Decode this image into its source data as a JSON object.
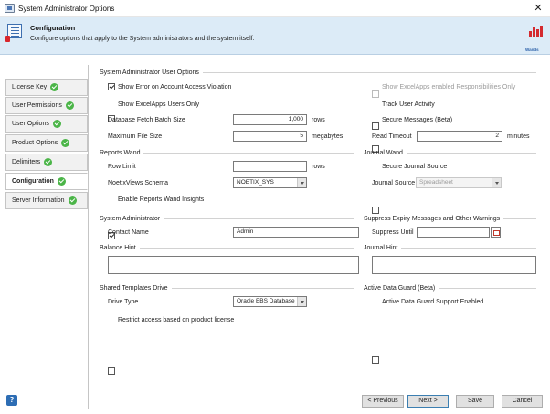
{
  "window": {
    "title": "System Administrator Options",
    "close_glyph": "✕"
  },
  "header": {
    "title": "Configuration",
    "description": "Configure options that apply to the System administrators and the system itself.",
    "logo_text": "Wands"
  },
  "nav": {
    "items": [
      {
        "label": "License Key",
        "done": true
      },
      {
        "label": "User Permissions",
        "done": true
      },
      {
        "label": "User Options",
        "done": true
      },
      {
        "label": "Product Options",
        "done": true
      },
      {
        "label": "Delimiters",
        "done": true
      },
      {
        "label": "Configuration",
        "done": true,
        "active": true
      },
      {
        "label": "Server Information",
        "done": true
      }
    ]
  },
  "sections": {
    "sys_admin_user_options": {
      "title": "System Administrator User Options",
      "show_error_on_violation": {
        "label": "Show Error on Account Access Violation",
        "checked": true
      },
      "show_excelapps_resp_only": {
        "label": "Show ExcelApps enabled Responsibilities Only",
        "checked": false,
        "disabled": true
      },
      "show_excelapps_users_only": {
        "label": "Show ExcelApps Users Only",
        "checked": false
      },
      "track_user_activity": {
        "label": "Track User Activity",
        "checked": false
      },
      "db_fetch_batch_size": {
        "label": "Database Fetch Batch Size",
        "value": "1,000",
        "unit": "rows"
      },
      "secure_messages": {
        "label": "Secure Messages (Beta)",
        "checked": false
      },
      "max_file_size": {
        "label": "Maximum File Size",
        "value": "5",
        "unit": "megabytes"
      },
      "read_timeout": {
        "label": "Read Timeout",
        "value": "2",
        "unit": "minutes"
      }
    },
    "reports_wand": {
      "title": "Reports Wand",
      "row_limit": {
        "label": "Row Limit",
        "value": "",
        "unit": "rows"
      },
      "views_schema": {
        "label": "NoetixViews Schema",
        "value": "NOETIX_SYS"
      },
      "enable_insights": {
        "label": "Enable Reports Wand Insights",
        "checked": true
      }
    },
    "journal_wand": {
      "title": "Journal Wand",
      "secure_journal_source": {
        "label": "Secure Journal Source",
        "checked": false
      },
      "journal_source": {
        "label": "Journal Source",
        "value": "Spreadsheet",
        "disabled": true
      }
    },
    "system_administrator": {
      "title": "System Administrator",
      "contact_name": {
        "label": "Contact Name",
        "value": "Admin"
      }
    },
    "suppress_expiry": {
      "title": "Suppress Expiry Messages and Other Warnings",
      "suppress_until": {
        "label": "Suppress Until",
        "value": ""
      }
    },
    "balance_hint": {
      "title": "Balance Hint",
      "value": ""
    },
    "journal_hint": {
      "title": "Journal Hint",
      "value": ""
    },
    "shared_templates_drive": {
      "title": "Shared Templates Drive",
      "drive_type": {
        "label": "Drive Type",
        "value": "Oracle EBS Database"
      },
      "restrict_access": {
        "label": "Restrict access based on product license",
        "checked": false
      }
    },
    "active_data_guard": {
      "title": "Active Data Guard (Beta)",
      "support_enabled": {
        "label": "Active Data Guard Support Enabled",
        "checked": false
      }
    }
  },
  "footer": {
    "help_label": "?",
    "previous_label": "< Previous",
    "next_label": "Next >",
    "save_label": "Save",
    "cancel_label": "Cancel"
  }
}
